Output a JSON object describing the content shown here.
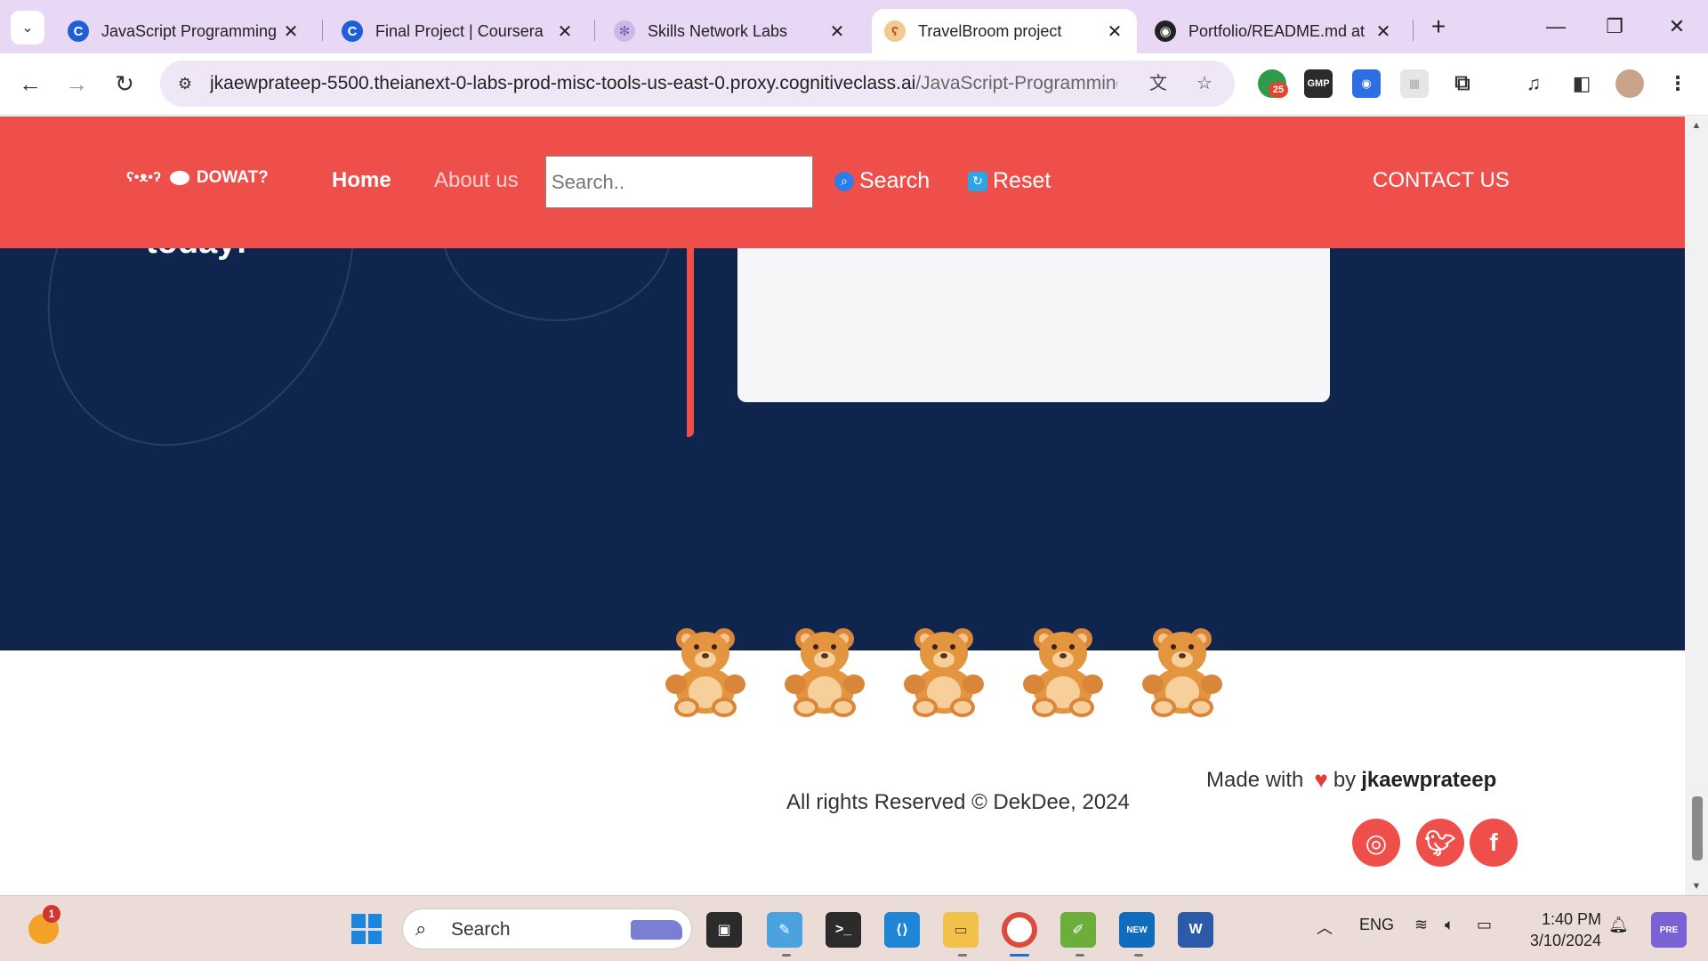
{
  "browser": {
    "tabs": [
      {
        "title": "JavaScript Programming with Node.js and Express.js",
        "icon": "coursera-icon",
        "active": false
      },
      {
        "title": "Final Project | Coursera",
        "icon": "coursera-icon",
        "active": false
      },
      {
        "title": "Skills Network Labs",
        "icon": "skills-network-icon",
        "active": false
      },
      {
        "title": "TravelBroom project",
        "icon": "bear-icon",
        "active": true
      },
      {
        "title": "Portfolio/README.md at",
        "icon": "github-icon",
        "active": false
      }
    ],
    "url_host": "jkaewprateep-5500.theianext-0-labs-prod-misc-tools-us-east-0.proxy.cognitiveclass.ai",
    "url_path": "/JavaScript-Programming...",
    "extension_badge": "25",
    "extension_gmp": "GMP"
  },
  "page": {
    "hero_tail_text": "today!",
    "navbar": {
      "logo_text": "DOWAT?",
      "home": "Home",
      "about": "About us",
      "search_placeholder": "Search..",
      "search_button": "Search",
      "reset_button": "Reset",
      "contact": "CONTACT US"
    },
    "footer": {
      "made_with": "Made with",
      "by": "by",
      "author": "jkaewprateep",
      "rights": "All rights Reserved © DekDee, 2024",
      "social": [
        "instagram-icon",
        "twitter-icon",
        "facebook-icon"
      ]
    },
    "colors": {
      "accent_red": "#ef4f4a",
      "dark_navy": "#10254e"
    }
  },
  "taskbar": {
    "weather_badge": "1",
    "search_label": "Search",
    "language": "ENG",
    "time": "1:40 PM",
    "date": "3/10/2024",
    "copilot_label": "PRE",
    "outlook_label": "NEW"
  }
}
